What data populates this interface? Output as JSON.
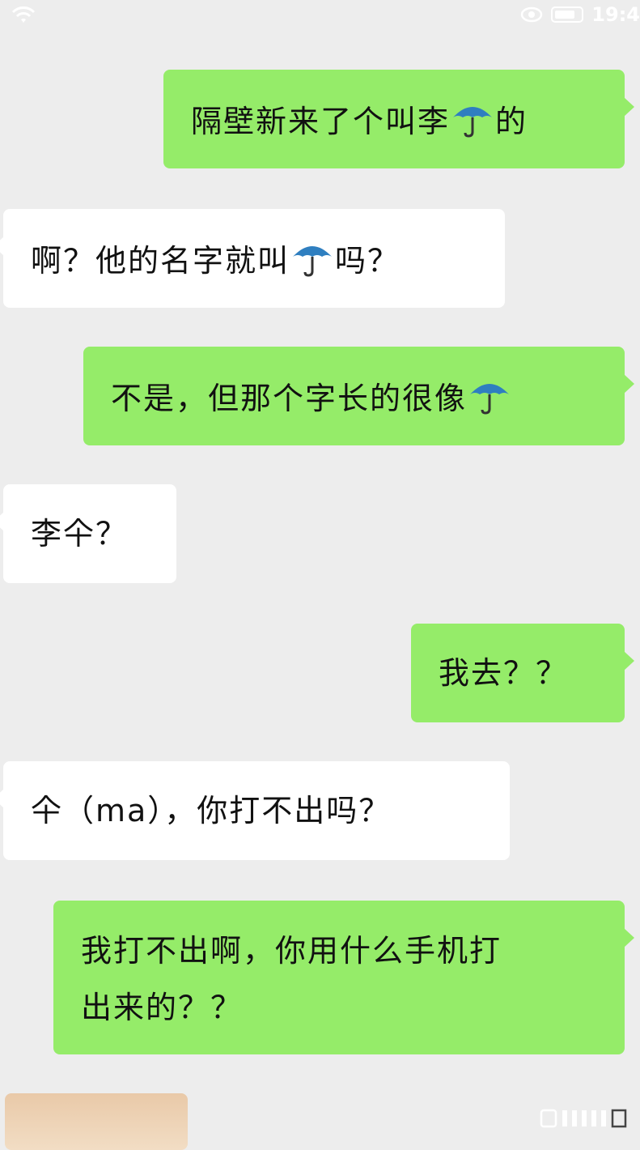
{
  "status_bar": {
    "time": "19:4"
  },
  "messages": [
    {
      "side": "right",
      "before": "隔壁新来了个叫李",
      "icon": "umbrella-icon",
      "after": "的"
    },
    {
      "side": "left",
      "before": "啊？他的名字就叫",
      "icon": "umbrella-icon",
      "after": "吗？"
    },
    {
      "side": "right",
      "before": "不是，但那个字长的很像",
      "icon": "umbrella-icon",
      "after": ""
    },
    {
      "side": "left",
      "text": "李仐？"
    },
    {
      "side": "right",
      "text": "我去？？"
    },
    {
      "side": "left",
      "text": "仐（ma），你打不出吗？"
    },
    {
      "side": "right",
      "line1": "我打不出啊，你用什么手机打",
      "line2": "出来的？？"
    }
  ],
  "colors": {
    "sent_bubble": "#95ec69",
    "received_bubble": "#ffffff",
    "background": "#ededed"
  }
}
